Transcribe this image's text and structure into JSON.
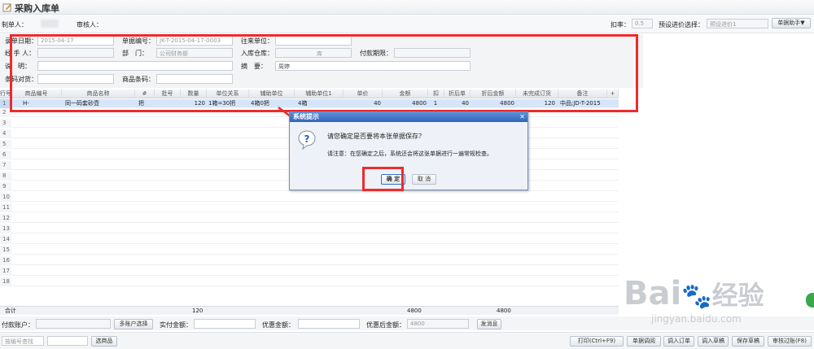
{
  "window": {
    "title": "采购入库单"
  },
  "header": {
    "maker_label": "制单人：",
    "reviewer_label": "审核人：",
    "discount_label": "扣率：",
    "discount_value": "0.5",
    "preset_label": "预设进价选择：",
    "preset_value": "预设进价1",
    "assist_button": "单据助手▼"
  },
  "form": {
    "date_label": "录单日期：",
    "date_value": "2015-04-17",
    "docno_label": "单据编号：",
    "docno_value": "JK-T-2015-04-17-0003",
    "partner_label": "往来单位：",
    "handler_label": "经 手 人：",
    "dept_label": "部　门：",
    "dept_value": "公司财务部",
    "warehouse_label": "入库仓库：",
    "warehouse_suffix": "库",
    "payterm_label": "付款期限：",
    "note_label": "说　明：",
    "summary_label": "摘　要：",
    "summary_value": "周婷",
    "barcode_check_label": "条码对货：",
    "barcode_label": "商品条码："
  },
  "table": {
    "columns": [
      "行号",
      "商品编号",
      "商品名称",
      "#",
      "批号",
      "数量",
      "单位关系",
      "辅助单位",
      "辅助单位1",
      "单价",
      "金额",
      "扣",
      "折后单",
      "折后金额",
      "未完成订货",
      "备注"
    ],
    "rows": [
      {
        "no": "1",
        "code": "H-",
        "name": "同一码套砂壶",
        "hash": "把",
        "batch": "",
        "qty": "120",
        "unitrel": "1箱=30把",
        "aux": "4箱0把",
        "aux1": "4箱",
        "price": "40",
        "amount": "4800",
        "disc": "1",
        "dprice": "40",
        "damount": "4800",
        "pending": "120",
        "remark": "中品;JD-T-2015"
      }
    ],
    "row_numbers": [
      "2",
      "3",
      "4",
      "5",
      "6",
      "7",
      "8",
      "9",
      "10",
      "11",
      "12",
      "13",
      "14",
      "15",
      "16",
      "17",
      "18"
    ],
    "totals_label": "合计",
    "totals_qty": "120",
    "totals_amount": "4800",
    "totals_damount": "4800"
  },
  "footer": {
    "pay_account_label": "付款账户：",
    "multi_account_button": "多账户选择",
    "actual_pay_label": "实付金额：",
    "discount_amount_label": "优惠金额：",
    "after_discount_label": "优惠后金额：",
    "after_discount_value": "4800",
    "send_message_button": "发消息",
    "search_placeholder": "按编号查找",
    "select_goods_button": "选商品",
    "print_button": "打印(Ctrl+F9)",
    "doc_adjust_button": "单据调阅",
    "import_order_button": "调入订单",
    "import_draft_button": "调入草稿",
    "save_draft_button": "保存草稿",
    "review_pass_button": "审核过账(F8)"
  },
  "dialog": {
    "title": "系统提示",
    "question": "请您确定是否要将本张单据保存？",
    "notice": "请注意：在您确定之后，系统还会将这张单据进行一遍常规检查。",
    "ok_button": "确 定",
    "cancel_button": "取 消"
  },
  "watermark": {
    "brand": "Bai",
    "brand2": "经验",
    "url": "jingyan.baidu.com"
  },
  "colors": {
    "highlight_red": "#ee2b2b",
    "dialog_title_blue": "#3166b8",
    "selected_row": "#d6e6fa"
  }
}
